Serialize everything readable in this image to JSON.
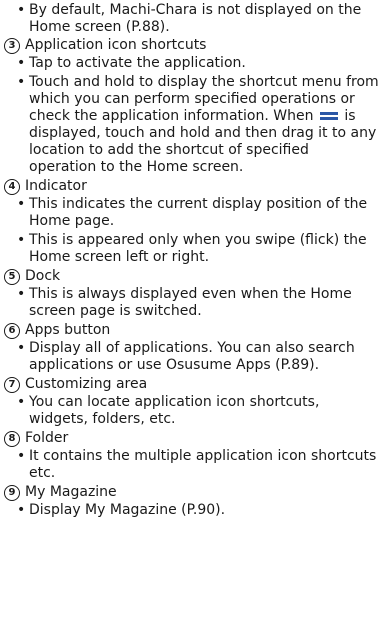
{
  "intro": {
    "bullet": "By default, Machi-Chara is not displayed on the Home screen (P.88)."
  },
  "sections": [
    {
      "number": "3",
      "title": "Application icon shortcuts",
      "bullets": [
        "Tap to activate the application.",
        "Touch and hold to display the shortcut menu from which you can perform specified operations or check the application information. When",
        "is displayed, touch and hold and then drag it to any location to add the shortcut of specified operation to the Home screen."
      ]
    },
    {
      "number": "4",
      "title": "Indicator",
      "bullets": [
        "This indicates the current display position of the Home page.",
        "This is appeared only when you swipe (flick) the Home screen left or right."
      ]
    },
    {
      "number": "5",
      "title": "Dock",
      "bullets": [
        "This is always displayed even when the Home screen page is switched."
      ]
    },
    {
      "number": "6",
      "title": "Apps button",
      "bullets": [
        "Display all of applications. You can also search applications or use Osusume Apps (P.89)."
      ]
    },
    {
      "number": "7",
      "title": "Customizing area",
      "bullets": [
        "You can locate application icon shortcuts, widgets, folders, etc."
      ]
    },
    {
      "number": "8",
      "title": "Folder",
      "bullets": [
        "It contains the multiple application icon shortcuts etc."
      ]
    },
    {
      "number": "9",
      "title": "My Magazine",
      "bullets": [
        "Display My Magazine (P.90)."
      ]
    }
  ],
  "icons": {
    "menu_icon": "menu-icon",
    "menu_icon_color": "#2b57a6"
  }
}
